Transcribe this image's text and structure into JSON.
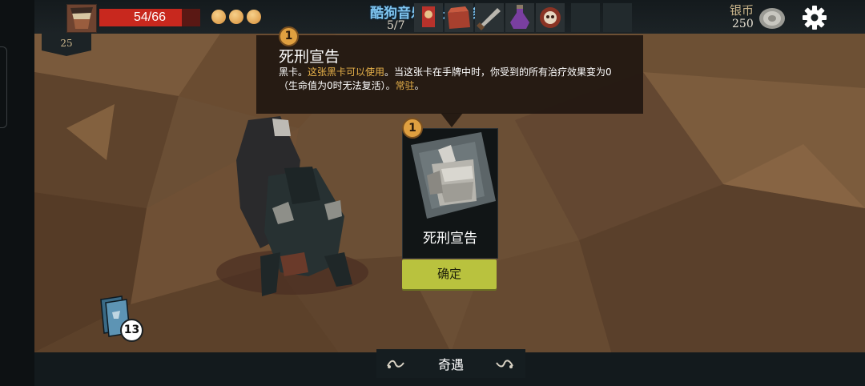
{
  "hud": {
    "hp_text": "54/66",
    "hp_fraction": 0.818,
    "level": "25",
    "energy_orbs": 3,
    "watermark": "酷狗音乐 就是歌多",
    "deck_progress": "5/7",
    "currency_label": "银币",
    "currency_value": "250"
  },
  "tooltip": {
    "badge": "1",
    "title": "死刑宣告",
    "line1_plain_a": "黑卡。",
    "line1_highlight_a": "这张黑卡可以使用",
    "line1_plain_b": "。当这张卡在手牌中时，你受到的所有治疗效果变为0",
    "line2_plain": "（生命值为0时无法复活）。",
    "line2_highlight": "常驻",
    "line2_end": "。"
  },
  "card": {
    "badge": "1",
    "name": "死刑宣告",
    "icon": "stone-fist-icon"
  },
  "confirm_label": "确定",
  "deck_count": "13",
  "bottom": {
    "label": "奇遇"
  },
  "colors": {
    "hp_red": "#c8281e",
    "gold": "#e0a040",
    "highlight": "#e8b24a",
    "confirm_bg": "#b9c23e"
  }
}
